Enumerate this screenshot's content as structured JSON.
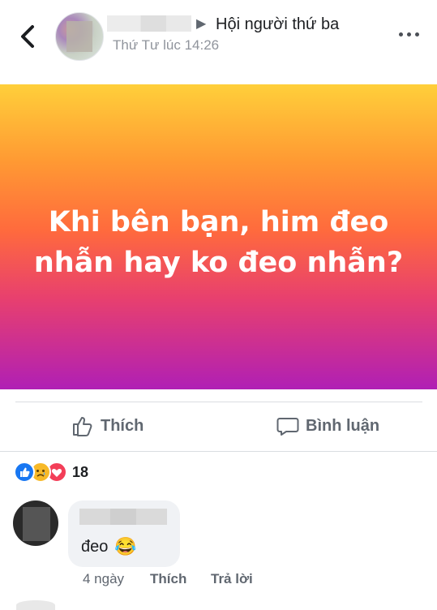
{
  "header": {
    "group_name": "Hội người thứ ba",
    "post_time": "Thứ Tư lúc 14:26",
    "back_icon": "chevron-left-icon",
    "more_icon": "more-horizontal-icon"
  },
  "post": {
    "text": "Khi bên bạn, him đeo nhẫn hay ko đeo nhẫn?",
    "gradient_colors": [
      "#ffcf3a",
      "#ff9a33",
      "#ff6a3d",
      "#e8406e",
      "#b01fb5"
    ]
  },
  "actions": {
    "like_label": "Thích",
    "comment_label": "Bình luận"
  },
  "reactions": {
    "types": [
      "like",
      "sad",
      "love"
    ],
    "count": "18"
  },
  "comment": {
    "text": "đeo",
    "emoji": "😂",
    "time": "4 ngày",
    "like_label": "Thích",
    "reply_label": "Trả lời"
  },
  "colors": {
    "like_blue": "#1877f2",
    "love_red": "#f33e58",
    "sad_yellow": "#f7b928",
    "secondary_text": "#606770"
  }
}
